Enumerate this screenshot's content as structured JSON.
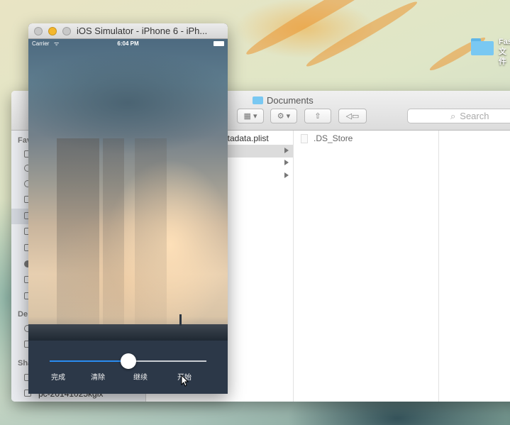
{
  "desktop": {
    "folder_label_line1": "Fas",
    "folder_label_line2": "文件"
  },
  "finder": {
    "path_title": "Documents",
    "search_placeholder": "Search",
    "sidebar_headers": [
      "Fav",
      "De",
      "Sha"
    ],
    "sidebar_shared_item": "pc-20141025kgix",
    "column1_partial_file": "etadata.plist",
    "column2_items": [
      ".DS_Store"
    ]
  },
  "simulator": {
    "window_title": "iOS Simulator - iPhone 6 - iPh...",
    "status": {
      "carrier": "Carrier",
      "time": "6:04 PM"
    },
    "slider_value_fraction": 0.5,
    "slider_progress_color": "#2a8cf0",
    "controls_bg": "#2c3848",
    "buttons": [
      "完成",
      "清除",
      "继续",
      "开始"
    ]
  },
  "traffic_colors": {
    "close": "#c8c8c8",
    "minimize": "#f4b72d",
    "zoom": "#c8c8c8"
  }
}
